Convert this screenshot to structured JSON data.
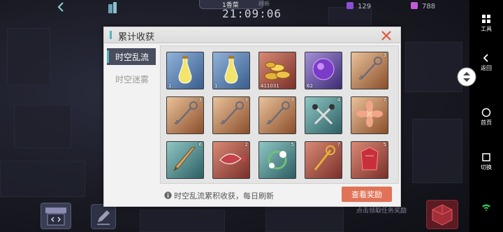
{
  "topbar": {
    "tab_label": "1香菜",
    "tab_dim_text": "刷新",
    "clock": "21:09:06",
    "resource_1": "129",
    "resource_2": "788"
  },
  "dialog": {
    "title": "累计收获",
    "tabs": [
      {
        "label": "时空乱流",
        "active": true
      },
      {
        "label": "时空迷雾",
        "active": false
      }
    ],
    "items": [
      {
        "kind": "bottle",
        "qty": "1",
        "qty_pos": "bl",
        "bg": "blue"
      },
      {
        "kind": "bottle",
        "qty": "1",
        "qty_pos": "bl",
        "bg": "blue"
      },
      {
        "kind": "coins",
        "qty": "411031",
        "qty_pos": "bl",
        "bg": "red"
      },
      {
        "kind": "orb",
        "qty": "62",
        "qty_pos": "bl",
        "bg": "purple"
      },
      {
        "kind": "key",
        "qty": "3",
        "qty_pos": "tr",
        "bg": "orange"
      },
      {
        "kind": "key",
        "qty": "3",
        "qty_pos": "tr",
        "bg": "orange"
      },
      {
        "kind": "key",
        "qty": "3",
        "qty_pos": "tr",
        "bg": "orange"
      },
      {
        "kind": "key",
        "qty": "3",
        "qty_pos": "tr",
        "bg": "orange"
      },
      {
        "kind": "scissors",
        "qty": "4",
        "qty_pos": "tr",
        "bg": "teal"
      },
      {
        "kind": "flower",
        "qty": "7",
        "qty_pos": "tr",
        "bg": "orange"
      },
      {
        "kind": "sword",
        "qty": "6",
        "qty_pos": "tr",
        "bg": "teal"
      },
      {
        "kind": "fish",
        "qty": "2",
        "qty_pos": "tr",
        "bg": "red"
      },
      {
        "kind": "wreath",
        "qty": "5",
        "qty_pos": "tr",
        "bg": "teal"
      },
      {
        "kind": "staff",
        "qty": "7",
        "qty_pos": "tr",
        "bg": "red"
      },
      {
        "kind": "armor",
        "qty": "5",
        "qty_pos": "tr",
        "bg": "red"
      }
    ],
    "footer_note": "时空乱流累积收获，每日刷新",
    "view_reward_button": "查看奖励"
  },
  "hud": {
    "task_hint": "点击领取任务奖励"
  },
  "sysbar": {
    "items": [
      {
        "label": "工具",
        "icon": "grid-icon"
      },
      {
        "label": "返回",
        "icon": "back-arrow-icon"
      },
      {
        "label": "首页",
        "icon": "home-circle-icon"
      },
      {
        "label": "切换",
        "icon": "switch-square-icon"
      }
    ]
  },
  "colors": {
    "accent_teal": "#4fb6c2",
    "button_orange": "#e07357",
    "close_red": "#e0583c"
  }
}
